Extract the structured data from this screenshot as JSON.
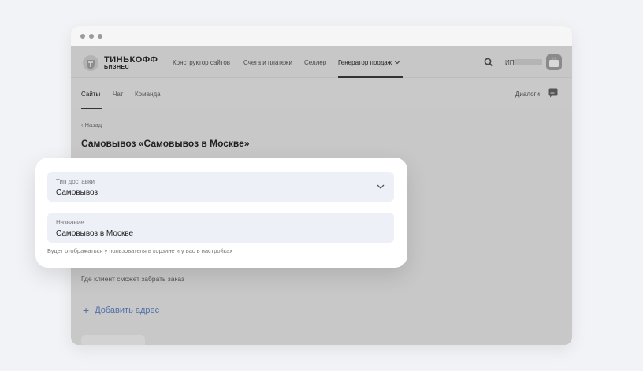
{
  "brand": {
    "name": "ТИНЬКОФФ",
    "sub": "БИЗНЕС"
  },
  "topnav": {
    "links": [
      {
        "label": "Конструктор сайтов"
      },
      {
        "label": "Счета и платежи"
      },
      {
        "label": "Селлер"
      },
      {
        "label": "Генератор продаж"
      }
    ],
    "user_prefix": "ИП"
  },
  "subnav": {
    "tabs": [
      {
        "label": "Сайты"
      },
      {
        "label": "Чат"
      },
      {
        "label": "Команда"
      }
    ],
    "dialogs_label": "Диалоги"
  },
  "page": {
    "back_label": "Назад",
    "title": "Самовывоз «Самовывоз в Москве»",
    "pickup_hint": "Где клиент сможет забрать заказ",
    "add_address_label": "Добавить адрес"
  },
  "form": {
    "delivery_type": {
      "label": "Тип доставки",
      "value": "Самовывоз"
    },
    "name": {
      "label": "Название",
      "value": "Самовывоз в Москве"
    },
    "hint": "Будет отображаться у пользователя в корзине и у вас в настройках"
  }
}
